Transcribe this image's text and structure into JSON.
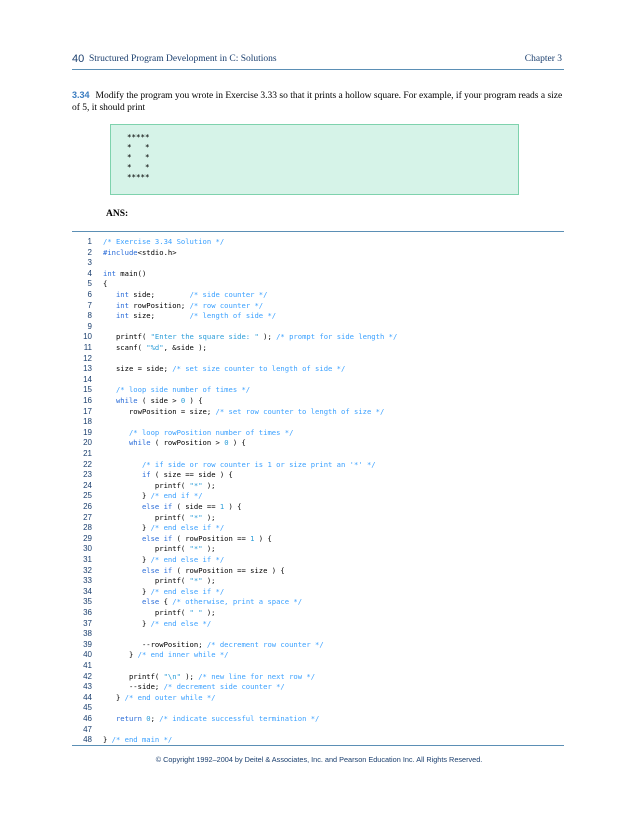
{
  "header": {
    "page_number": "40",
    "title": "Structured Program Development in C: Solutions",
    "chapter": "Chapter  3"
  },
  "exercise": {
    "number": "3.34",
    "text": "Modify the program you wrote in Exercise 3.33 so that it prints a hollow square. For example, if your program reads a size of 5, it should print"
  },
  "output_box": {
    "lines": [
      "*****",
      "*   *",
      "*   *",
      "*   *",
      "*****"
    ]
  },
  "answer_label": "ANS:",
  "code": {
    "lines": [
      {
        "n": "1",
        "t": "/* Exercise 3.34 Solution */"
      },
      {
        "n": "2",
        "t": "#include<stdio.h>"
      },
      {
        "n": "3",
        "t": ""
      },
      {
        "n": "4",
        "t": "int main()"
      },
      {
        "n": "5",
        "t": "{"
      },
      {
        "n": "6",
        "t": "   int side;        /* side counter */"
      },
      {
        "n": "7",
        "t": "   int rowPosition; /* row counter */"
      },
      {
        "n": "8",
        "t": "   int size;        /* length of side */"
      },
      {
        "n": "9",
        "t": ""
      },
      {
        "n": "10",
        "t": "   printf( \"Enter the square side: \" ); /* prompt for side length */"
      },
      {
        "n": "11",
        "t": "   scanf( \"%d\", &side );"
      },
      {
        "n": "12",
        "t": ""
      },
      {
        "n": "13",
        "t": "   size = side; /* set size counter to length of side */"
      },
      {
        "n": "14",
        "t": ""
      },
      {
        "n": "15",
        "t": "   /* loop side number of times */"
      },
      {
        "n": "16",
        "t": "   while ( side > 0 ) {"
      },
      {
        "n": "17",
        "t": "      rowPosition = size; /* set row counter to length of size */"
      },
      {
        "n": "18",
        "t": ""
      },
      {
        "n": "19",
        "t": "      /* loop rowPosition number of times */"
      },
      {
        "n": "20",
        "t": "      while ( rowPosition > 0 ) {"
      },
      {
        "n": "21",
        "t": ""
      },
      {
        "n": "22",
        "t": "         /* if side or row counter is 1 or size print an '*' */"
      },
      {
        "n": "23",
        "t": "         if ( size == side ) {"
      },
      {
        "n": "24",
        "t": "            printf( \"*\" );"
      },
      {
        "n": "25",
        "t": "         } /* end if */"
      },
      {
        "n": "26",
        "t": "         else if ( side == 1 ) {"
      },
      {
        "n": "27",
        "t": "            printf( \"*\" );"
      },
      {
        "n": "28",
        "t": "         } /* end else if */"
      },
      {
        "n": "29",
        "t": "         else if ( rowPosition == 1 ) {"
      },
      {
        "n": "30",
        "t": "            printf( \"*\" );"
      },
      {
        "n": "31",
        "t": "         } /* end else if */"
      },
      {
        "n": "32",
        "t": "         else if ( rowPosition == size ) {"
      },
      {
        "n": "33",
        "t": "            printf( \"*\" );"
      },
      {
        "n": "34",
        "t": "         } /* end else if */"
      },
      {
        "n": "35",
        "t": "         else { /* otherwise, print a space */"
      },
      {
        "n": "36",
        "t": "            printf( \" \" );"
      },
      {
        "n": "37",
        "t": "         } /* end else */"
      },
      {
        "n": "38",
        "t": ""
      },
      {
        "n": "39",
        "t": "         --rowPosition; /* decrement row counter */"
      },
      {
        "n": "40",
        "t": "      } /* end inner while */"
      },
      {
        "n": "41",
        "t": ""
      },
      {
        "n": "42",
        "t": "      printf( \"\\n\" ); /* new line for next row */"
      },
      {
        "n": "43",
        "t": "      --side; /* decrement side counter */"
      },
      {
        "n": "44",
        "t": "   } /* end outer while */"
      },
      {
        "n": "45",
        "t": ""
      },
      {
        "n": "46",
        "t": "   return 0; /* indicate successful termination */"
      },
      {
        "n": "47",
        "t": ""
      },
      {
        "n": "48",
        "t": "} /* end main */"
      }
    ]
  },
  "footer": "© Copyright 1992–2004 by Deitel & Associates, Inc. and Pearson Education Inc. All Rights Reserved."
}
